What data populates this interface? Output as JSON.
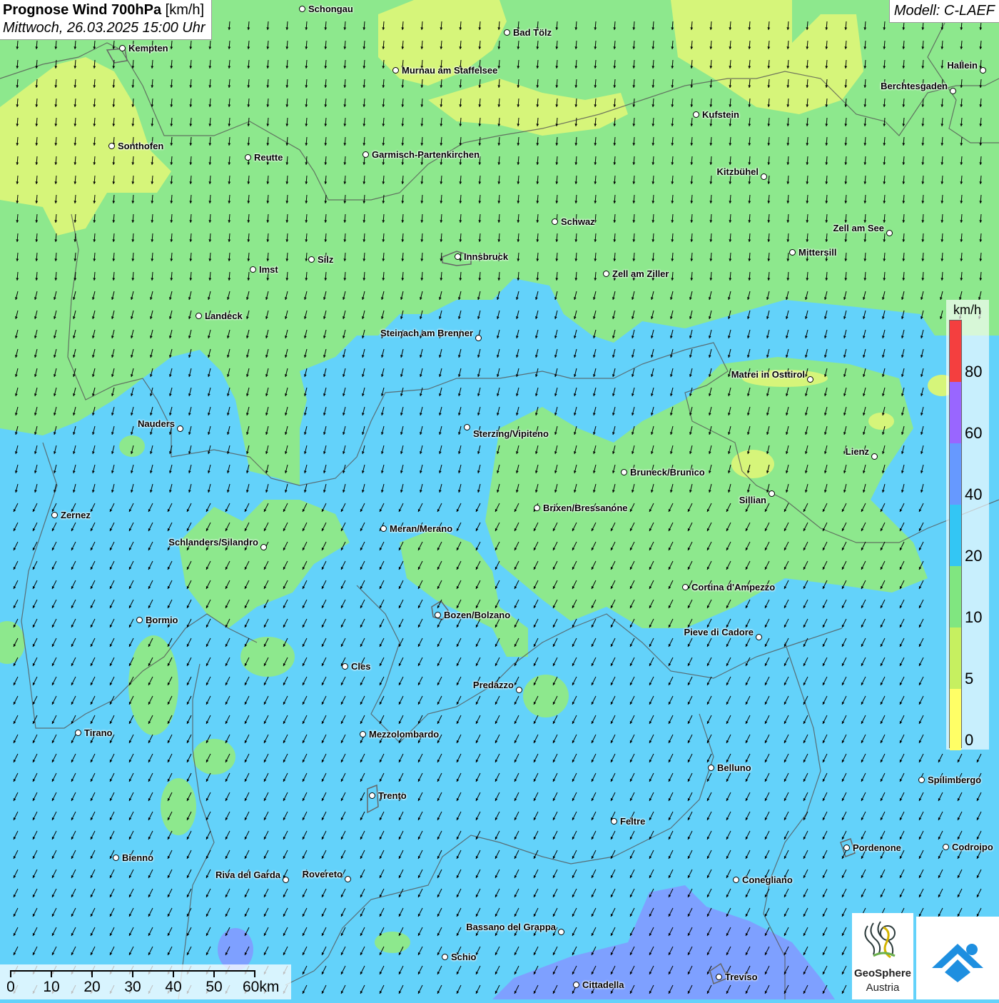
{
  "header": {
    "title_bold": "Prognose Wind 700hPa",
    "title_unit": " [km/h]",
    "subtitle": "Mittwoch, 26.03.2025 15:00 Uhr"
  },
  "model_label": "Modell: C-LAEF",
  "legend": {
    "unit": "km/h",
    "ticks": [
      "80",
      "60",
      "40",
      "20",
      "10",
      "5",
      "0"
    ],
    "colors": [
      "#f43f3f",
      "#9966ff",
      "#6699ff",
      "#33c6f4",
      "#80e680",
      "#c6f060",
      "#ffff66"
    ]
  },
  "scalebar": {
    "labels": [
      "0",
      "10",
      "20",
      "30",
      "40",
      "50",
      "60km"
    ]
  },
  "logo": {
    "name_bold": "GeoSphere",
    "name_sub": "Austria"
  },
  "colors": {
    "wind_0_5": "#ffff66",
    "wind_5_10": "#d6f57a",
    "wind_10_20": "#8de88d",
    "wind_20_40": "#63d2fa",
    "wind_40_60": "#7ea0ff",
    "arrow": "#000000"
  },
  "cities": [
    {
      "name": "Schongau",
      "id": "schongau"
    },
    {
      "name": "Bad Tölz",
      "id": "bad-toelz"
    },
    {
      "name": "Kempten",
      "id": "kempten"
    },
    {
      "name": "Murnau am Staffelsee",
      "id": "murnau"
    },
    {
      "name": "Hallein",
      "id": "hallein"
    },
    {
      "name": "Berchtesgaden",
      "id": "berchtesgaden"
    },
    {
      "name": "Kufstein",
      "id": "kufstein"
    },
    {
      "name": "Sonthofen",
      "id": "sonthofen"
    },
    {
      "name": "Reutte",
      "id": "reutte"
    },
    {
      "name": "Garmisch-Partenkirchen",
      "id": "garmisch"
    },
    {
      "name": "Kitzbühel",
      "id": "kitzbuehel"
    },
    {
      "name": "Schwaz",
      "id": "schwaz"
    },
    {
      "name": "Zell am See",
      "id": "zell-am-see"
    },
    {
      "name": "Mittersill",
      "id": "mittersill"
    },
    {
      "name": "Silz",
      "id": "silz"
    },
    {
      "name": "Innsbruck",
      "id": "innsbruck"
    },
    {
      "name": "Imst",
      "id": "imst"
    },
    {
      "name": "Zell am Ziller",
      "id": "zell-am-ziller"
    },
    {
      "name": "Landeck",
      "id": "landeck"
    },
    {
      "name": "Steinach am Brenner",
      "id": "steinach"
    },
    {
      "name": "Matrei in Osttirol",
      "id": "matrei"
    },
    {
      "name": "Nauders",
      "id": "nauders"
    },
    {
      "name": "Sterzing/Vipiteno",
      "id": "sterzing"
    },
    {
      "name": "Lienz",
      "id": "lienz"
    },
    {
      "name": "Bruneck/Brunico",
      "id": "bruneck"
    },
    {
      "name": "Sillian",
      "id": "sillian"
    },
    {
      "name": "Brixen/Bressanone",
      "id": "brixen"
    },
    {
      "name": "Zernez",
      "id": "zernez"
    },
    {
      "name": "Meran/Merano",
      "id": "meran"
    },
    {
      "name": "Schlanders/Silandro",
      "id": "schlanders"
    },
    {
      "name": "Cortina d'Ampezzo",
      "id": "cortina"
    },
    {
      "name": "Bozen/Bolzano",
      "id": "bozen"
    },
    {
      "name": "Bormio",
      "id": "bormio"
    },
    {
      "name": "Pieve di Cadore",
      "id": "pieve"
    },
    {
      "name": "Cles",
      "id": "cles"
    },
    {
      "name": "Predazzo",
      "id": "predazzo"
    },
    {
      "name": "Tirano",
      "id": "tirano"
    },
    {
      "name": "Mezzolombardo",
      "id": "mezzolombardo"
    },
    {
      "name": "Belluno",
      "id": "belluno"
    },
    {
      "name": "Spilimbergo",
      "id": "spilimbergo"
    },
    {
      "name": "Trento",
      "id": "trento"
    },
    {
      "name": "Feltre",
      "id": "feltre"
    },
    {
      "name": "Pordenone",
      "id": "pordenone"
    },
    {
      "name": "Codroipo",
      "id": "codroipo"
    },
    {
      "name": "Bienno",
      "id": "bienno"
    },
    {
      "name": "Riva del Garda",
      "id": "riva"
    },
    {
      "name": "Rovereto",
      "id": "rovereto"
    },
    {
      "name": "Conegliano",
      "id": "conegliano"
    },
    {
      "name": "Bassano del Grappa",
      "id": "bassano"
    },
    {
      "name": "Schio",
      "id": "schio"
    },
    {
      "name": "Treviso",
      "id": "treviso"
    },
    {
      "name": "Cittadella",
      "id": "cittadella"
    }
  ]
}
